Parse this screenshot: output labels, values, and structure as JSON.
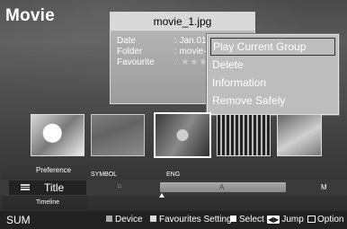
{
  "page": {
    "title": "Movie"
  },
  "info_popup": {
    "filename": "movie_1.jpg",
    "rows": [
      {
        "label": "Date",
        "value": ": Jan.01"
      },
      {
        "label": "Folder",
        "value": ": movie-"
      },
      {
        "label": "Favourite",
        "value": ": ★★★"
      }
    ]
  },
  "context_menu": {
    "items": [
      {
        "label": "Play Current Group",
        "selected": true
      },
      {
        "label": "Delete"
      },
      {
        "label": "Information"
      },
      {
        "label": "Remove Safely"
      }
    ]
  },
  "sort_bar": {
    "preference": "Preference",
    "current": "Title",
    "timeline": "Timeline",
    "symbol": "SYMBOL",
    "eng": "ENG",
    "square": "□",
    "a_mark": "A",
    "m_mark": "M"
  },
  "footer": {
    "sum": "SUM",
    "device": "Device",
    "favourites": "Favourites Setting",
    "select": "Select",
    "jump": "Jump",
    "option": "Option",
    "jump_key": "◀▶"
  },
  "colors": {
    "menu_bg": "#bdbdbd",
    "info_bg": "#a8a8a8",
    "footer_bg": "#222222"
  }
}
